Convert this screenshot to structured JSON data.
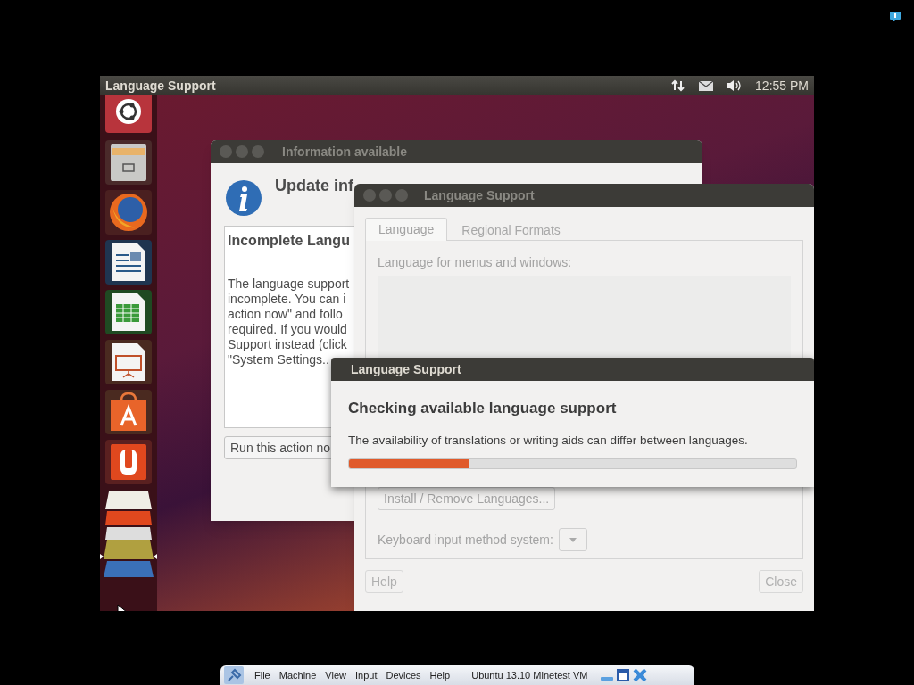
{
  "top_panel": {
    "title": "Language Support",
    "clock": "12:55 PM"
  },
  "info_dialog": {
    "title": "Information available",
    "heading": "Update inf",
    "subheading": "Incomplete Langu",
    "body_lines": [
      "The language support",
      "incomplete. You can i",
      "action now\" and follo",
      "required. If you would",
      "Support instead (click",
      "\"System Settings.."
    ],
    "button": "Run this action no"
  },
  "language_window": {
    "title": "Language Support",
    "disabled": true,
    "tabs": [
      {
        "label": "Language",
        "selected": true
      },
      {
        "label": "Regional Formats",
        "selected": false
      }
    ],
    "list_label": "Language for menus and windows:",
    "install_button": "Install / Remove Languages...",
    "keyboard_label": "Keyboard input method system:",
    "buttons": [
      "Help",
      "Close"
    ]
  },
  "progress_dialog": {
    "title": "Language Support",
    "heading": "Checking available language support",
    "message": "The availability of translations or writing aids can differ between languages.",
    "level": 0.27
  },
  "vm_bar": {
    "menus": [
      "File",
      "Machine",
      "View",
      "Input",
      "Devices",
      "Help"
    ],
    "vm_name": "Ubuntu 13.10 Minetest VM"
  }
}
